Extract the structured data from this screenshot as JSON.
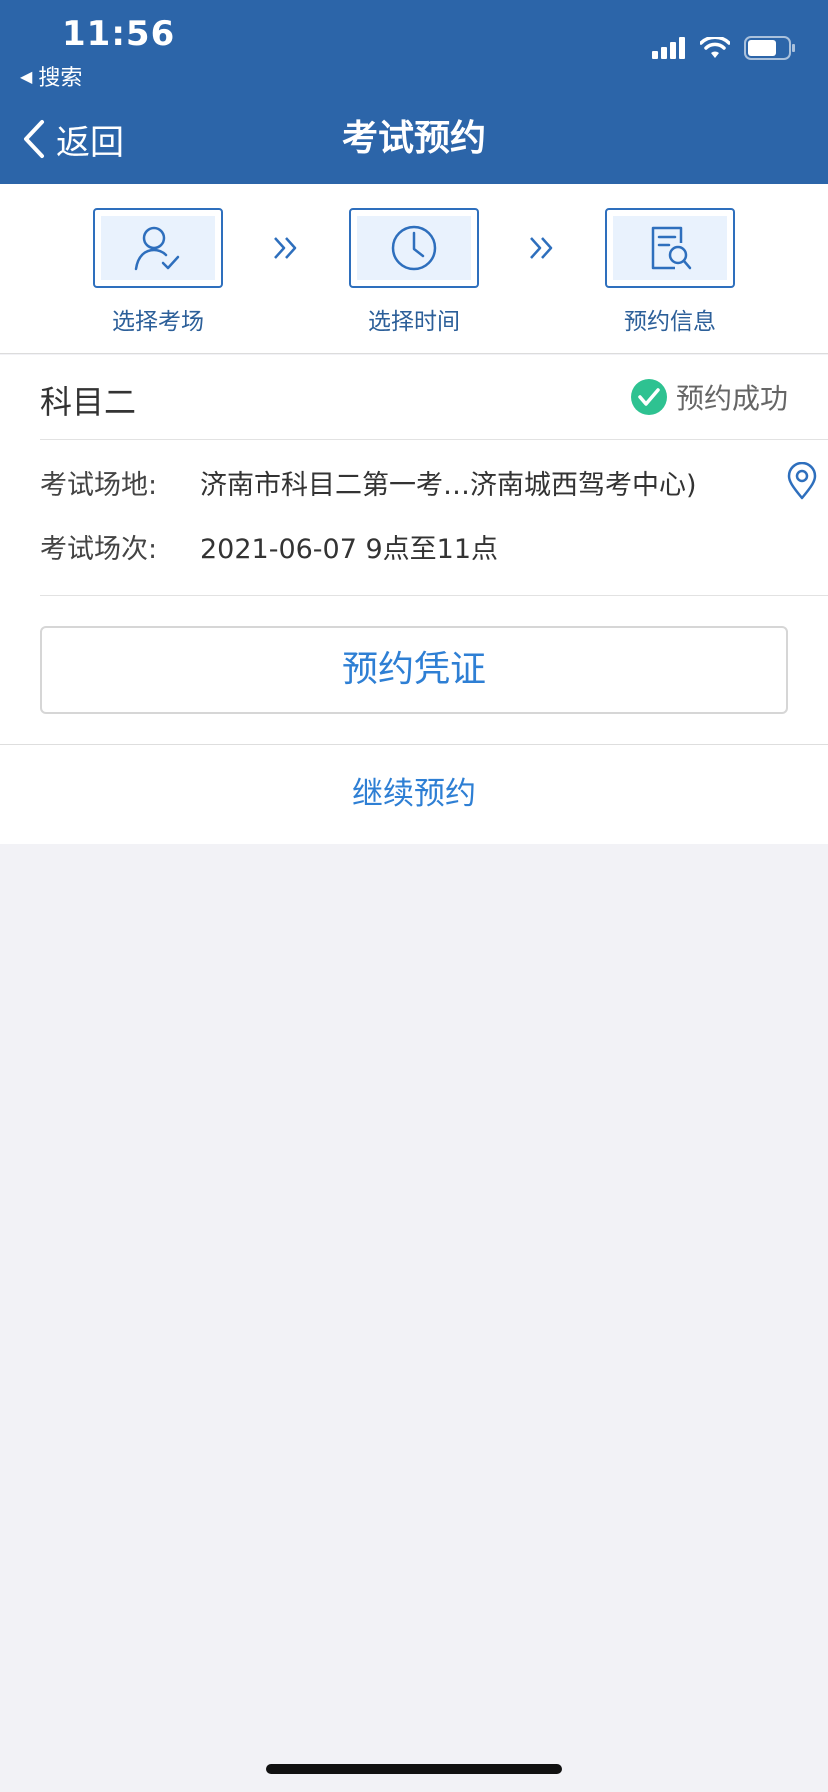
{
  "status_bar": {
    "time": "11:56",
    "back_app": "搜索",
    "icons": [
      "signal-icon",
      "wifi-icon",
      "battery-icon"
    ]
  },
  "nav": {
    "back_label": "返回",
    "title": "考试预约"
  },
  "steps": [
    {
      "label": "选择考场",
      "icon": "person-check-icon"
    },
    {
      "label": "选择时间",
      "icon": "clock-icon"
    },
    {
      "label": "预约信息",
      "icon": "document-search-icon"
    }
  ],
  "booking": {
    "subject": "科目二",
    "status": "预约成功",
    "venue_label": "考试场地:",
    "venue_value": "济南市科目二第一考…济南城西驾考中心)",
    "session_label": "考试场次:",
    "session_value": "2021-06-07 9点至11点"
  },
  "actions": {
    "voucher": "预约凭证",
    "continue": "继续预约"
  },
  "colors": {
    "header": "#2c65a9",
    "accent": "#2e7fd4",
    "success": "#2ec291",
    "background": "#f2f2f6"
  }
}
